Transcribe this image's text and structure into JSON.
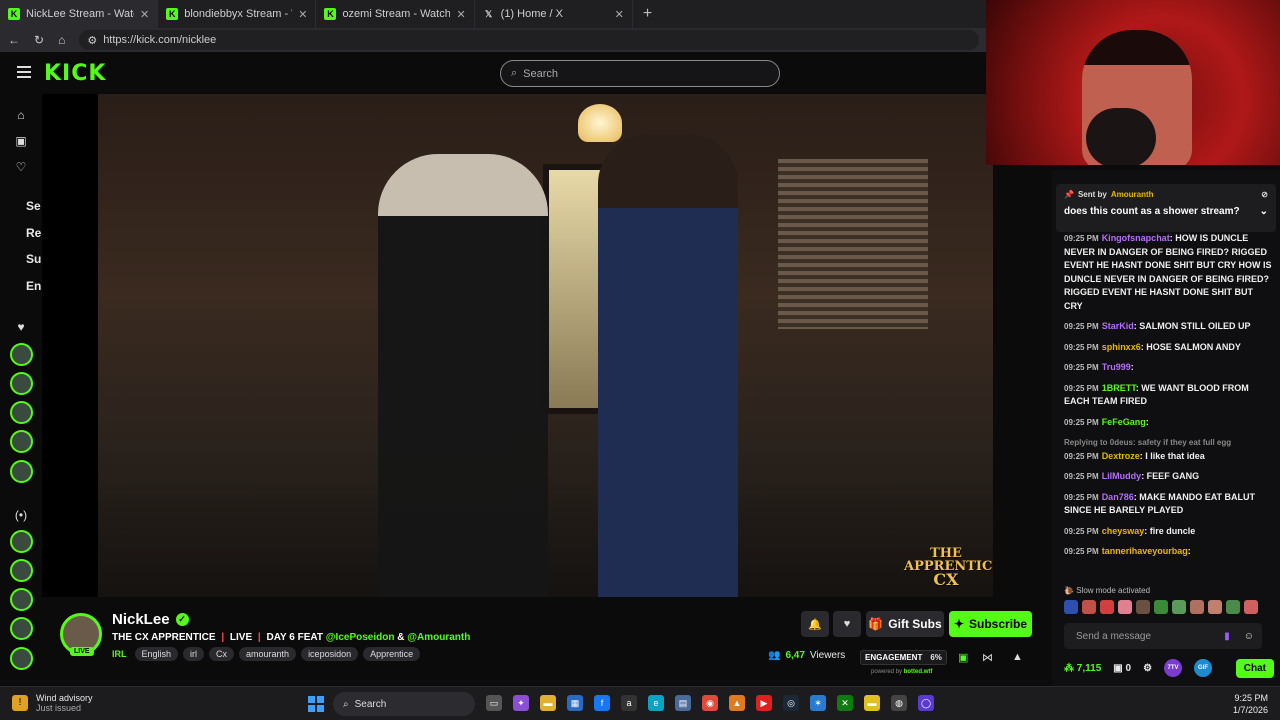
{
  "browser": {
    "tabs": [
      {
        "label": "NickLee Stream - Watch Live",
        "favicon": "kick-icon"
      },
      {
        "label": "blondiebbyx Stream - Watch",
        "favicon": "kick-icon"
      },
      {
        "label": "ozemi Stream - Watch Live or",
        "favicon": "kick-icon"
      },
      {
        "label": "(1) Home / X",
        "favicon": "x-icon"
      }
    ],
    "url": "https://kick.com/nicklee"
  },
  "kick": {
    "logo": "KICK",
    "search_placeholder": "Search",
    "brand_color": "#53fc18"
  },
  "sidebar": {
    "sections": [
      "Se",
      "Re",
      "Su",
      "En"
    ]
  },
  "video": {
    "watermark_line1": "THE",
    "watermark_line2": "APPRENTICE",
    "watermark_line3": "CX"
  },
  "stream": {
    "channel": "NickLee",
    "live_label": "LIVE",
    "title_part1": "THE CX APPRENTICE",
    "title_sep": "|",
    "title_part2": "LIVE",
    "title_part3": "DAY 6 FEAT",
    "mention1": "@IcePoseidon",
    "amp": "&",
    "mention2": "@Amouranth",
    "category": "IRL",
    "tags": [
      "English",
      "irl",
      "Cx",
      "amouranth",
      "iceposidon",
      "Apprentice"
    ],
    "gift_label": "Gift Subs",
    "subscribe_label": "Subscribe",
    "viewers_count": "6,47",
    "viewers_label": "Viewers",
    "engagement_label": "ENGAGEMENT",
    "engagement_value": "6%",
    "powered_prefix": "powered by",
    "powered_brand": "botted.wtf"
  },
  "chat": {
    "pinned_sender_prefix": "Sent by",
    "pinned_sender": "Amouranth",
    "pinned_message": "does this count as a shower stream?",
    "messages": [
      {
        "ts": "09:25 PM",
        "user": "Kingofsnapchat",
        "color": "#b56cff",
        "text": ": HOW IS DUNCLE NEVER IN DANGER OF BEING FIRED? RIGGED EVENT HE HASNT DONE SHIT BUT CRY HOW IS DUNCLE NEVER IN DANGER OF BEING FIRED? RIGGED EVENT HE HASNT DONE SHIT BUT CRY"
      },
      {
        "ts": "09:25 PM",
        "user": "StarKid",
        "color": "#b56cff",
        "text": ": SALMON STILL OILED UP"
      },
      {
        "ts": "09:25 PM",
        "user": "sphinxx6",
        "color": "#e6b800",
        "text": ": HOSE SALMON ANDY"
      },
      {
        "ts": "09:25 PM",
        "user": "Tru999",
        "color": "#b56cff",
        "text": ":"
      },
      {
        "ts": "09:25 PM",
        "user": "1BRETT",
        "color": "#53fc18",
        "text": ": WE WANT BLOOD FROM EACH TEAM FIRED"
      },
      {
        "ts": "09:25 PM",
        "user": "FeFeGang",
        "color": "#53fc18",
        "text": ":"
      },
      {
        "ts": "09:25 PM",
        "user": "Dextroze",
        "color": "#e6b800",
        "text": ": I like that idea",
        "reply": "Replying to 0deus: safety if they eat full egg"
      },
      {
        "ts": "09:25 PM",
        "user": "LilMuddy",
        "color": "#b56cff",
        "text": ": FEEF GANG"
      },
      {
        "ts": "09:25 PM",
        "user": "Dan786",
        "color": "#b56cff",
        "text": ": MAKE MANDO EAT BALUT SINCE HE BARELY PLAYED"
      },
      {
        "ts": "09:25 PM",
        "user": "cheysway",
        "color": "#e6b800",
        "text": ": fire duncle"
      },
      {
        "ts": "09:25 PM",
        "user": "tannerihaveyourbag",
        "color": "#e6b800",
        "text": ":"
      }
    ],
    "slow_mode": "Slow mode activated",
    "send_placeholder": "Send a message",
    "points": "7,115",
    "badge_count": "0",
    "chat_button": "Chat",
    "ttv_label": "7TV",
    "gif_label": "GIF"
  },
  "taskbar": {
    "weather_title": "Wind advisory",
    "weather_sub": "Just issued",
    "search_label": "Search",
    "time": "9:25 PM",
    "date": "1/7/2026"
  }
}
